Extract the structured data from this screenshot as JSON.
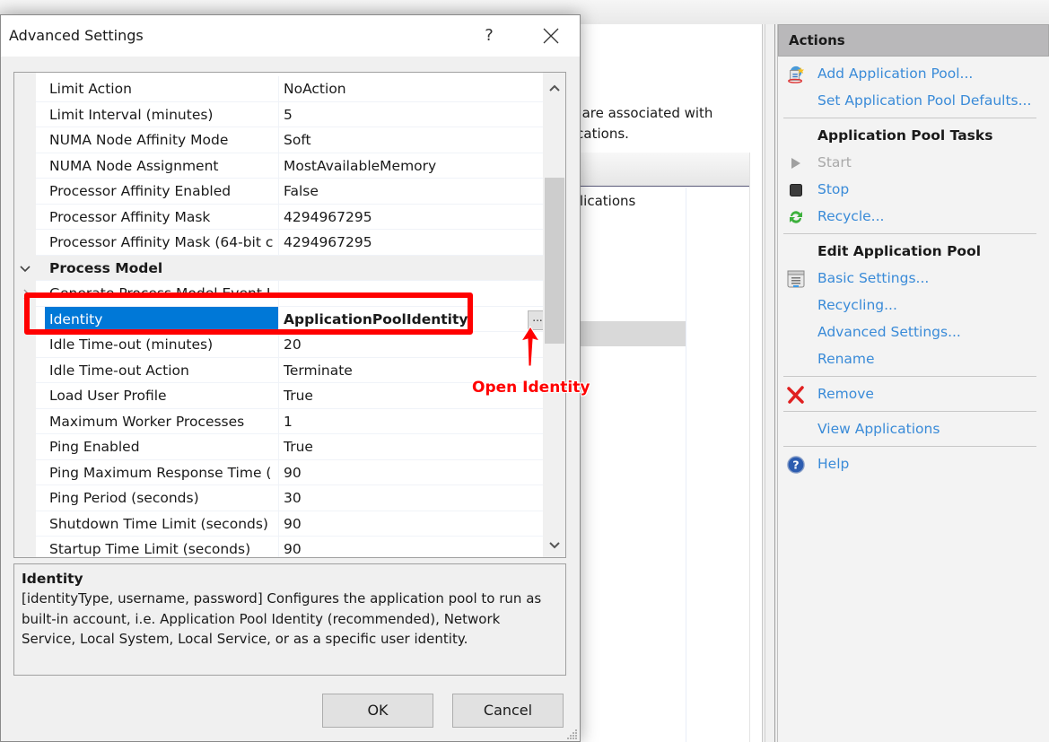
{
  "background": {
    "description_lines": [
      "s are associated with",
      "ications."
    ],
    "table_cell": "lications"
  },
  "actions": {
    "header": "Actions",
    "items": [
      {
        "type": "link",
        "label": "Add Application Pool...",
        "icon": "add-app-pool-icon",
        "enabled": true
      },
      {
        "type": "link",
        "label": "Set Application Pool Defaults...",
        "icon": null,
        "enabled": true
      },
      {
        "type": "separator"
      },
      {
        "type": "title",
        "label": "Application Pool Tasks"
      },
      {
        "type": "link",
        "label": "Start",
        "icon": "play-icon",
        "enabled": false
      },
      {
        "type": "link",
        "label": "Stop",
        "icon": "stop-icon",
        "enabled": true
      },
      {
        "type": "link",
        "label": "Recycle...",
        "icon": "recycle-icon",
        "enabled": true
      },
      {
        "type": "separator"
      },
      {
        "type": "title",
        "label": "Edit Application Pool"
      },
      {
        "type": "link",
        "label": "Basic Settings...",
        "icon": "settings-icon",
        "enabled": true
      },
      {
        "type": "link",
        "label": "Recycling...",
        "icon": null,
        "enabled": true
      },
      {
        "type": "link",
        "label": "Advanced Settings...",
        "icon": null,
        "enabled": true
      },
      {
        "type": "link",
        "label": "Rename",
        "icon": null,
        "enabled": true
      },
      {
        "type": "separator"
      },
      {
        "type": "link",
        "label": "Remove",
        "icon": "remove-x-icon",
        "enabled": true
      },
      {
        "type": "separator"
      },
      {
        "type": "link",
        "label": "View Applications",
        "icon": null,
        "enabled": true
      },
      {
        "type": "separator"
      },
      {
        "type": "link",
        "label": "Help",
        "icon": "help-icon",
        "enabled": true
      }
    ]
  },
  "dialog": {
    "title": "Advanced Settings",
    "help_label": "?",
    "properties": [
      {
        "name": "Limit Action",
        "value": "NoAction"
      },
      {
        "name": "Limit Interval (minutes)",
        "value": "5"
      },
      {
        "name": "NUMA Node Affinity Mode",
        "value": "Soft"
      },
      {
        "name": "NUMA Node Assignment",
        "value": "MostAvailableMemory"
      },
      {
        "name": "Processor Affinity Enabled",
        "value": "False"
      },
      {
        "name": "Processor Affinity Mask",
        "value": "4294967295"
      },
      {
        "name": "Processor Affinity Mask (64-bit c",
        "value": "4294967295"
      },
      {
        "name": "Process Model",
        "value": "",
        "category": true,
        "expanded": true
      },
      {
        "name": "Generate Process Model Event L",
        "value": "",
        "collapsed_child": true
      },
      {
        "name": "Identity",
        "value": "ApplicationPoolIdentity",
        "selected": true,
        "has_ellipsis": true
      },
      {
        "name": "Idle Time-out (minutes)",
        "value": "20"
      },
      {
        "name": "Idle Time-out Action",
        "value": "Terminate"
      },
      {
        "name": "Load User Profile",
        "value": "True"
      },
      {
        "name": "Maximum Worker Processes",
        "value": "1"
      },
      {
        "name": "Ping Enabled",
        "value": "True"
      },
      {
        "name": "Ping Maximum Response Time (",
        "value": "90"
      },
      {
        "name": "Ping Period (seconds)",
        "value": "30"
      },
      {
        "name": "Shutdown Time Limit (seconds)",
        "value": "90"
      },
      {
        "name": "Startup Time Limit (seconds)",
        "value": "90"
      }
    ],
    "ellipsis_label": "...",
    "description": {
      "title": "Identity",
      "text": "[identityType, username, password] Configures the application pool to run as built-in account, i.e. Application Pool Identity (recommended), Network Service, Local System, Local Service, or as a specific user identity."
    },
    "ok_label": "OK",
    "cancel_label": "Cancel"
  },
  "annotation": {
    "label": "Open Identity",
    "color": "#ff0000"
  },
  "colors": {
    "selection": "#0078d7",
    "link": "#3a8bd8",
    "disabled": "#a9a9a9"
  }
}
